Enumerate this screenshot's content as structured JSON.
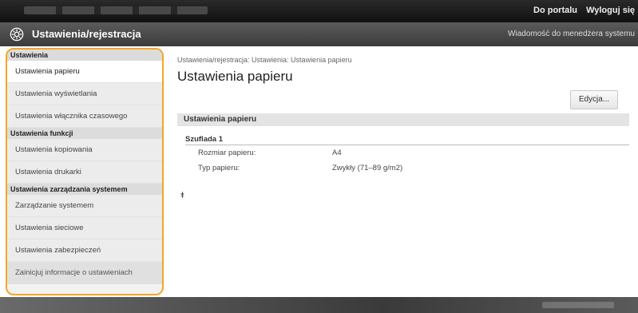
{
  "header": {
    "portal_link": "Do portalu",
    "logout_link": "Wyloguj się",
    "section_title": "Ustawienia/rejestracja",
    "message_link": "Wiadomość do menedżera systemu"
  },
  "sidebar": {
    "groups": [
      {
        "title": "Ustawienia",
        "items": [
          "Ustawienia papieru",
          "Ustawienia wyświetlania",
          "Ustawienia włącznika czasowego"
        ]
      },
      {
        "title": "Ustawienia funkcji",
        "items": [
          "Ustawienia kopiowania",
          "Ustawienia drukarki"
        ]
      },
      {
        "title": "Ustawienia zarządzania systemem",
        "items": [
          "Zarządzanie systemem",
          "Ustawienia sieciowe",
          "Ustawienia zabezpieczeń",
          "Zainicjuj informacje o ustawieniach"
        ]
      }
    ],
    "selected": "Ustawienia papieru"
  },
  "main": {
    "breadcrumb": "Ustawienia/rejestracja: Ustawienia: Ustawienia papieru",
    "title": "Ustawienia papieru",
    "edit_button": "Edycja...",
    "section_header": "Ustawienia papieru",
    "tray_label": "Szuflada 1",
    "rows": [
      {
        "label": "Rozmiar papieru:",
        "value": "A4"
      },
      {
        "label": "Typ papieru:",
        "value": "Zwykły (71–89 g/m2)"
      }
    ],
    "top_link_icon": "⯒"
  }
}
